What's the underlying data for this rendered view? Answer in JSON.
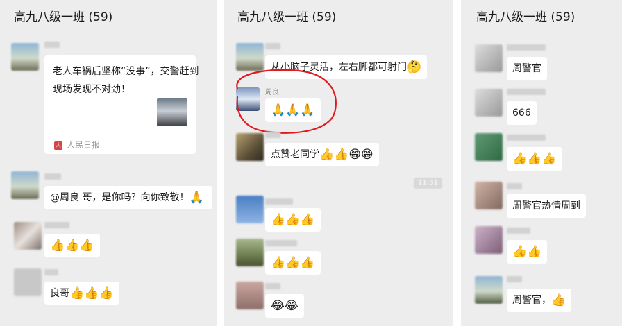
{
  "panel1": {
    "title": "高九八级一班 (59)",
    "card": {
      "text": "老人车祸后坚称“没事”，交警赶到现场发现不对劲！",
      "source": "人民日报",
      "source_icon": "people-daily-logo-icon"
    },
    "messages": [
      {
        "text": "@周良 哥，是你吗？向你致敬！",
        "emoji": "🙏"
      },
      {
        "text": "",
        "emoji": "👍👍👍"
      },
      {
        "text": "良哥",
        "emoji": "👍👍👍"
      }
    ]
  },
  "panel2": {
    "title": "高九八级一班 (59)",
    "messages": [
      {
        "nickname": "",
        "text": "从小脑子灵活，左右脚都可射门",
        "emoji": "🤔"
      },
      {
        "nickname": "周良",
        "text": "",
        "emoji": "🙏🙏🙏"
      },
      {
        "nickname": "",
        "text": "点赞老同学",
        "emoji": "👍👍😁😁"
      },
      {
        "nickname": "",
        "text": "",
        "emoji": "👍👍👍"
      },
      {
        "nickname": "",
        "text": "",
        "emoji": "👍👍👍"
      },
      {
        "nickname": "",
        "text": "",
        "emoji": "😂😂"
      }
    ],
    "timestamp": "11:31",
    "highlight_color": "#e0191c"
  },
  "panel3": {
    "title": "高九八级一班 (59)",
    "messages": [
      {
        "text": "周警官",
        "emoji": ""
      },
      {
        "text": "666",
        "emoji": ""
      },
      {
        "text": "",
        "emoji": "👍👍👍"
      },
      {
        "text": "周警官热情周到",
        "emoji": ""
      },
      {
        "text": "",
        "emoji": "👍👍"
      },
      {
        "text": "周警官，",
        "emoji": "👍"
      }
    ]
  },
  "colors": {
    "chat_background": "#ededed",
    "bubble": "#ffffff",
    "circle": "#e0191c"
  }
}
